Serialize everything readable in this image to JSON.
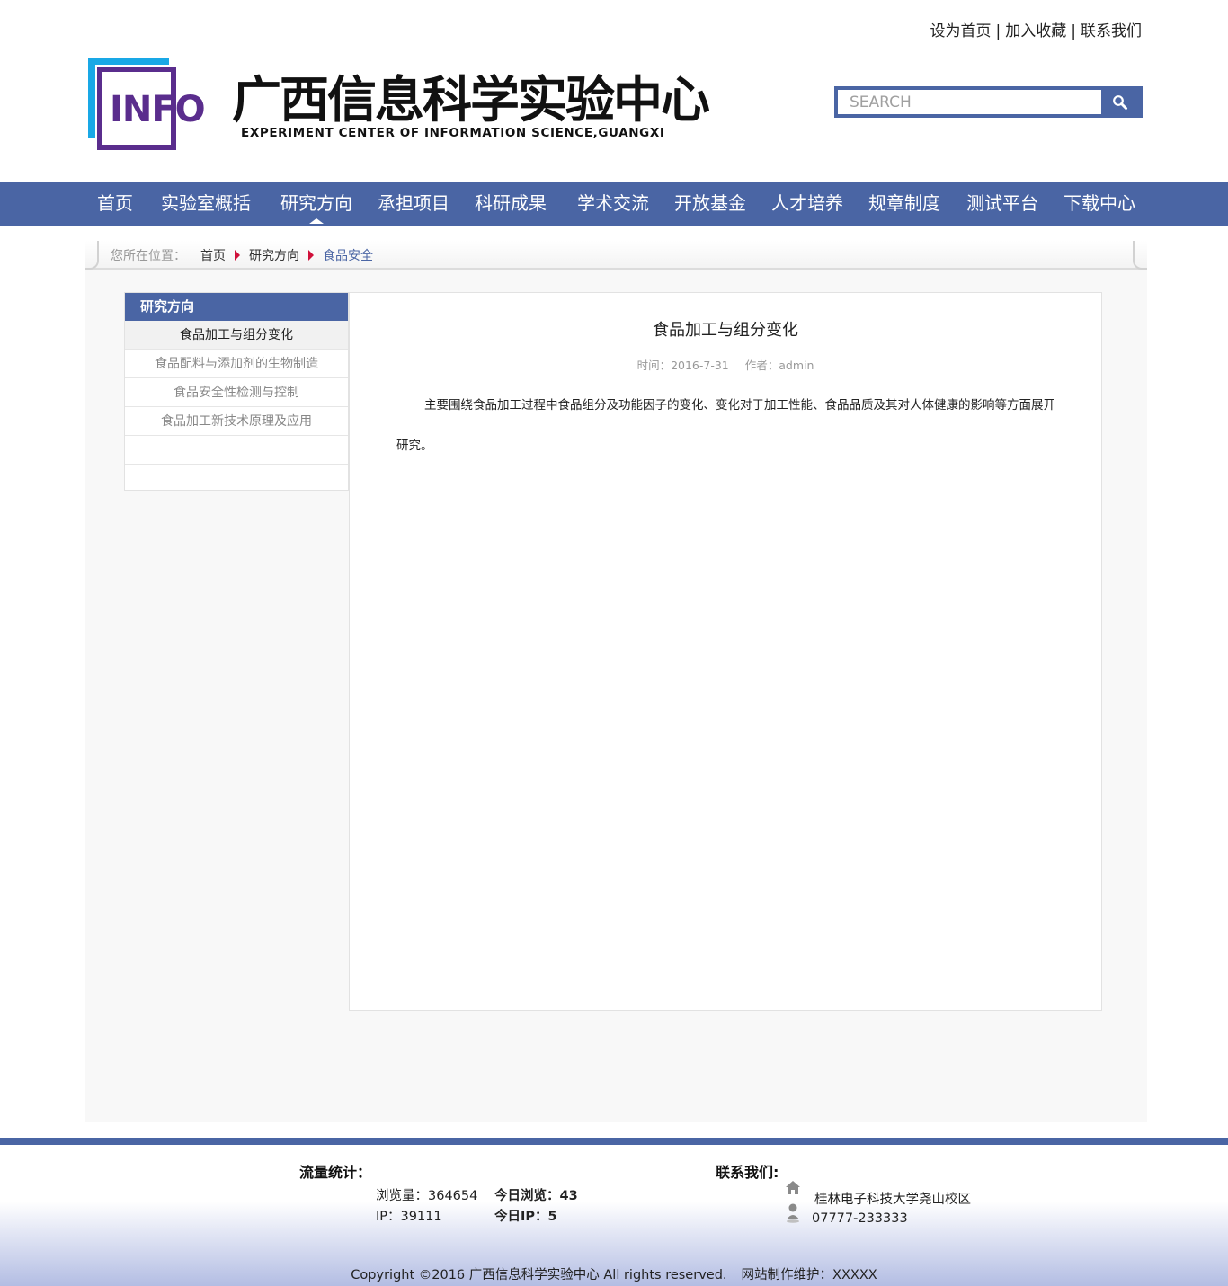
{
  "top_links": [
    "设为首页",
    "加入收藏",
    "联系我们"
  ],
  "top_link_separator": "|",
  "logo": {
    "mark": "INFO",
    "title": "广西信息科学实验中心",
    "subtitle": "EXPERIMENT CENTER OF INFORMATION SCIENCE,GUANGXI"
  },
  "search": {
    "placeholder": "SEARCH",
    "icon": "search-icon"
  },
  "nav": {
    "items": [
      "首页",
      "实验室概括",
      "研究方向",
      "承担项目",
      "科研成果",
      "学术交流",
      "开放基金",
      "人才培养",
      "规章制度",
      "测试平台",
      "下载中心"
    ],
    "active_index": 2
  },
  "breadcrumb": {
    "label": "您所在位置：",
    "items": [
      "首页",
      "研究方向",
      "食品安全"
    ]
  },
  "sidebar": {
    "title": "研究方向",
    "items": [
      "食品加工与组分变化",
      "食品配料与添加剂的生物制造",
      "食品安全性检测与控制",
      "食品加工新技术原理及应用",
      ""
    ],
    "active_index": 0
  },
  "article": {
    "title": "食品加工与组分变化",
    "date": "时间：2016-7-31",
    "author": "作者：admin",
    "body": "主要围绕食品加工过程中食品组分及功能因子的变化、变化对于加工性能、食品品质及其对人体健康的影响等方面展开研究。"
  },
  "footer": {
    "stats_title": "流量统计：",
    "views": "浏览量：364654",
    "today_views": "今日浏览：43",
    "ip": "IP：39111",
    "today_ip": "今日IP：5",
    "contact_title": "联系我们:",
    "address": "桂林电子科技大学尧山校区",
    "phone": "07777-233333",
    "copyright": "Copyright ©2016 广西信息科学实验中心 All rights reserved.",
    "maintainer": "网站制作维护：XXXXX"
  },
  "colors": {
    "brand_blue": "#4a65a4",
    "logo_purple": "#5a2d8d",
    "logo_cyan": "#19a8e6",
    "crumb_arrow": "#d0103a"
  }
}
